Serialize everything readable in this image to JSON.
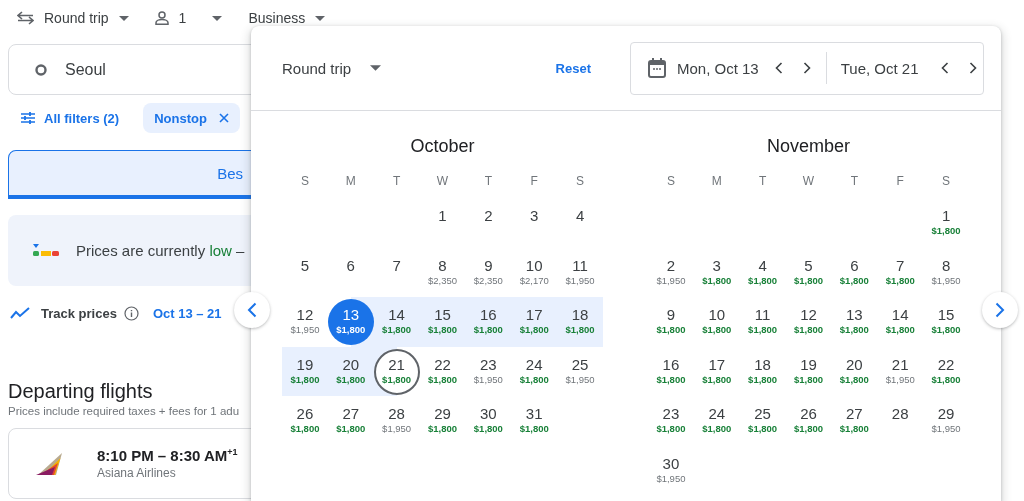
{
  "topbar": {
    "trip_type": "Round trip",
    "passengers": "1",
    "cabin": "Business"
  },
  "search": {
    "origin": "Seoul"
  },
  "filters": {
    "all_filters": "All filters (2)",
    "chips": [
      {
        "label": "Nonstop"
      }
    ]
  },
  "sort_tab": {
    "label": "Bes",
    "selected": true
  },
  "insight": {
    "text": "Prices are currently **low** –"
  },
  "track": {
    "label": "Track prices",
    "dates": "Oct 13 – 21"
  },
  "departing": {
    "title": "Departing flights",
    "subtitle": "Prices include required taxes + fees for 1 adu"
  },
  "flights": [
    {
      "times": "8:10 PM – 8:30 AM$^{+1}$",
      "airline": "Asiana Airlines"
    }
  ],
  "calendar": {
    "trip_type": "Round trip",
    "reset": "Reset",
    "depart": "Mon, Oct 13",
    "return": "Tue, Oct 21",
    "months": [
      {
        "name": "October",
        "weekdays": [
          "S",
          "M",
          "T",
          "W",
          "T",
          "F",
          "S"
        ],
        "weeks": [
          [
            {
              "kind": "blank"
            },
            {
              "kind": "blank"
            },
            {
              "kind": "blank"
            },
            {
              "kind": "day",
              "day": "1",
              "selected": false,
              "in_range": false,
              "focused": false
            },
            {
              "kind": "day",
              "day": "2",
              "selected": false,
              "in_range": false,
              "focused": false
            },
            {
              "kind": "day",
              "day": "3",
              "selected": false,
              "in_range": false,
              "focused": false
            },
            {
              "kind": "day",
              "day": "4",
              "selected": false,
              "in_range": false,
              "focused": false
            }
          ],
          [
            {
              "kind": "day",
              "day": "5",
              "selected": false,
              "in_range": false,
              "focused": false
            },
            {
              "kind": "day",
              "day": "6",
              "selected": false,
              "in_range": false,
              "focused": false
            },
            {
              "kind": "day",
              "day": "7",
              "selected": false,
              "in_range": false,
              "focused": false
            },
            {
              "kind": "day",
              "day": "8",
              "price": "$2,350",
              "low": false,
              "selected": false,
              "in_range": false,
              "focused": false
            },
            {
              "kind": "day",
              "day": "9",
              "price": "$2,350",
              "low": false,
              "selected": false,
              "in_range": false,
              "focused": false
            },
            {
              "kind": "day",
              "day": "10",
              "price": "$2,170",
              "low": false,
              "selected": false,
              "in_range": false,
              "focused": false
            },
            {
              "kind": "day",
              "day": "11",
              "price": "$1,950",
              "low": false,
              "selected": false,
              "in_range": false,
              "focused": false
            }
          ],
          [
            {
              "kind": "day",
              "day": "12",
              "price": "$1,950",
              "low": false,
              "selected": false,
              "in_range": false,
              "focused": false
            },
            {
              "kind": "day",
              "day": "13",
              "price": "$1,800",
              "low": true,
              "selected": true,
              "in_range": true,
              "focused": false
            },
            {
              "kind": "day",
              "day": "14",
              "price": "$1,800",
              "low": true,
              "selected": false,
              "in_range": true,
              "focused": false
            },
            {
              "kind": "day",
              "day": "15",
              "price": "$1,800",
              "low": true,
              "selected": false,
              "in_range": true,
              "focused": false
            },
            {
              "kind": "day",
              "day": "16",
              "price": "$1,800",
              "low": true,
              "selected": false,
              "in_range": true,
              "focused": false
            },
            {
              "kind": "day",
              "day": "17",
              "price": "$1,800",
              "low": true,
              "selected": false,
              "in_range": true,
              "focused": false
            },
            {
              "kind": "day",
              "day": "18",
              "price": "$1,800",
              "low": true,
              "selected": false,
              "in_range": true,
              "focused": false
            }
          ],
          [
            {
              "kind": "day",
              "day": "19",
              "price": "$1,800",
              "low": true,
              "selected": false,
              "in_range": true,
              "focused": false
            },
            {
              "kind": "day",
              "day": "20",
              "price": "$1,800",
              "low": true,
              "selected": false,
              "in_range": true,
              "focused": false
            },
            {
              "kind": "day",
              "day": "21",
              "price": "$1,800",
              "low": true,
              "selected": false,
              "in_range": true,
              "focused": true
            },
            {
              "kind": "day",
              "day": "22",
              "price": "$1,800",
              "low": true,
              "selected": false,
              "in_range": false,
              "focused": false
            },
            {
              "kind": "day",
              "day": "23",
              "price": "$1,950",
              "low": false,
              "selected": false,
              "in_range": false,
              "focused": false
            },
            {
              "kind": "day",
              "day": "24",
              "price": "$1,800",
              "low": true,
              "selected": false,
              "in_range": false,
              "focused": false
            },
            {
              "kind": "day",
              "day": "25",
              "price": "$1,950",
              "low": false,
              "selected": false,
              "in_range": false,
              "focused": false
            }
          ],
          [
            {
              "kind": "day",
              "day": "26",
              "price": "$1,800",
              "low": true,
              "selected": false,
              "in_range": false,
              "focused": false
            },
            {
              "kind": "day",
              "day": "27",
              "price": "$1,800",
              "low": true,
              "selected": false,
              "in_range": false,
              "focused": false
            },
            {
              "kind": "day",
              "day": "28",
              "price": "$1,950",
              "low": false,
              "selected": false,
              "in_range": false,
              "focused": false
            },
            {
              "kind": "day",
              "day": "29",
              "price": "$1,800",
              "low": true,
              "selected": false,
              "in_range": false,
              "focused": false
            },
            {
              "kind": "day",
              "day": "30",
              "price": "$1,800",
              "low": true,
              "selected": false,
              "in_range": false,
              "focused": false
            },
            {
              "kind": "day",
              "day": "31",
              "price": "$1,800",
              "low": true,
              "selected": false,
              "in_range": false,
              "focused": false
            }
          ]
        ]
      },
      {
        "name": "November",
        "weekdays": [
          "S",
          "M",
          "T",
          "W",
          "T",
          "F",
          "S"
        ],
        "weeks": [
          [
            {
              "kind": "blank"
            },
            {
              "kind": "blank"
            },
            {
              "kind": "blank"
            },
            {
              "kind": "blank"
            },
            {
              "kind": "blank"
            },
            {
              "kind": "blank"
            },
            {
              "kind": "day",
              "day": "1",
              "price": "$1,800",
              "low": true,
              "selected": false,
              "in_range": false,
              "focused": false
            }
          ],
          [
            {
              "kind": "day",
              "day": "2",
              "price": "$1,950",
              "low": false,
              "selected": false,
              "in_range": false,
              "focused": false
            },
            {
              "kind": "day",
              "day": "3",
              "price": "$1,800",
              "low": true,
              "selected": false,
              "in_range": false,
              "focused": false
            },
            {
              "kind": "day",
              "day": "4",
              "price": "$1,800",
              "low": true,
              "selected": false,
              "in_range": false,
              "focused": false
            },
            {
              "kind": "day",
              "day": "5",
              "price": "$1,800",
              "low": true,
              "selected": false,
              "in_range": false,
              "focused": false
            },
            {
              "kind": "day",
              "day": "6",
              "price": "$1,800",
              "low": true,
              "selected": false,
              "in_range": false,
              "focused": false
            },
            {
              "kind": "day",
              "day": "7",
              "price": "$1,800",
              "low": true,
              "selected": false,
              "in_range": false,
              "focused": false
            },
            {
              "kind": "day",
              "day": "8",
              "price": "$1,950",
              "low": false,
              "selected": false,
              "in_range": false,
              "focused": false
            }
          ],
          [
            {
              "kind": "day",
              "day": "9",
              "price": "$1,800",
              "low": true,
              "selected": false,
              "in_range": false,
              "focused": false
            },
            {
              "kind": "day",
              "day": "10",
              "price": "$1,800",
              "low": true,
              "selected": false,
              "in_range": false,
              "focused": false
            },
            {
              "kind": "day",
              "day": "11",
              "price": "$1,800",
              "low": true,
              "selected": false,
              "in_range": false,
              "focused": false
            },
            {
              "kind": "day",
              "day": "12",
              "price": "$1,800",
              "low": true,
              "selected": false,
              "in_range": false,
              "focused": false
            },
            {
              "kind": "day",
              "day": "13",
              "price": "$1,800",
              "low": true,
              "selected": false,
              "in_range": false,
              "focused": false
            },
            {
              "kind": "day",
              "day": "14",
              "price": "$1,800",
              "low": true,
              "selected": false,
              "in_range": false,
              "focused": false
            },
            {
              "kind": "day",
              "day": "15",
              "price": "$1,800",
              "low": true,
              "selected": false,
              "in_range": false,
              "focused": false
            }
          ],
          [
            {
              "kind": "day",
              "day": "16",
              "price": "$1,800",
              "low": true,
              "selected": false,
              "in_range": false,
              "focused": false
            },
            {
              "kind": "day",
              "day": "17",
              "price": "$1,800",
              "low": true,
              "selected": false,
              "in_range": false,
              "focused": false
            },
            {
              "kind": "day",
              "day": "18",
              "price": "$1,800",
              "low": true,
              "selected": false,
              "in_range": false,
              "focused": false
            },
            {
              "kind": "day",
              "day": "19",
              "price": "$1,800",
              "low": true,
              "selected": false,
              "in_range": false,
              "focused": false
            },
            {
              "kind": "day",
              "day": "20",
              "price": "$1,800",
              "low": true,
              "selected": false,
              "in_range": false,
              "focused": false
            },
            {
              "kind": "day",
              "day": "21",
              "price": "$1,950",
              "low": false,
              "selected": false,
              "in_range": false,
              "focused": false
            },
            {
              "kind": "day",
              "day": "22",
              "price": "$1,800",
              "low": true,
              "selected": false,
              "in_range": false,
              "focused": false
            }
          ],
          [
            {
              "kind": "day",
              "day": "23",
              "price": "$1,800",
              "low": true,
              "selected": false,
              "in_range": false,
              "focused": false
            },
            {
              "kind": "day",
              "day": "24",
              "price": "$1,800",
              "low": true,
              "selected": false,
              "in_range": false,
              "focused": false
            },
            {
              "kind": "day",
              "day": "25",
              "price": "$1,800",
              "low": true,
              "selected": false,
              "in_range": false,
              "focused": false
            },
            {
              "kind": "day",
              "day": "26",
              "price": "$1,800",
              "low": true,
              "selected": false,
              "in_range": false,
              "focused": false
            },
            {
              "kind": "day",
              "day": "27",
              "price": "$1,800",
              "low": true,
              "selected": false,
              "in_range": false,
              "focused": false
            },
            {
              "kind": "day",
              "day": "28",
              "selected": false,
              "in_range": false,
              "focused": false
            },
            {
              "kind": "day",
              "day": "29",
              "price": "$1,950",
              "low": false,
              "selected": false,
              "in_range": false,
              "focused": false
            }
          ],
          [
            {
              "kind": "day",
              "day": "30",
              "price": "$1,950",
              "low": false,
              "selected": false,
              "in_range": false,
              "focused": false
            }
          ]
        ]
      }
    ]
  }
}
